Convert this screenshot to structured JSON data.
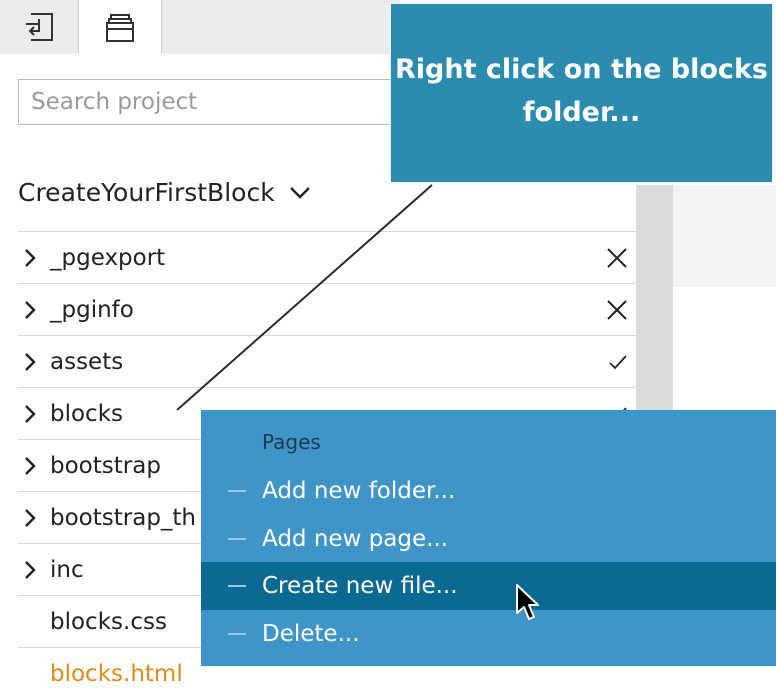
{
  "tabs": [
    {
      "icon": "export-icon"
    },
    {
      "icon": "project-archive-icon"
    }
  ],
  "search": {
    "placeholder": "Search project"
  },
  "project": {
    "title": "CreateYourFirstBlock"
  },
  "tree": [
    {
      "label": "_pgexport",
      "status": "x"
    },
    {
      "label": "_pginfo",
      "status": "x"
    },
    {
      "label": "assets",
      "status": "check"
    },
    {
      "label": "blocks",
      "status": "check"
    },
    {
      "label": "bootstrap",
      "status": ""
    },
    {
      "label": "bootstrap_th",
      "status": ""
    },
    {
      "label": "inc",
      "status": ""
    },
    {
      "label": "blocks.css",
      "status": ""
    },
    {
      "label": "blocks.html",
      "status": ""
    }
  ],
  "callout": {
    "text": "Right click on the blocks folder..."
  },
  "context_menu": {
    "header": "Pages",
    "items": [
      "Add new folder...",
      "Add new page...",
      "Create new file...",
      "Delete..."
    ],
    "selected_index": 2
  },
  "colors": {
    "callout_bg": "#2b8cb0",
    "menu_bg": "#3f95c7",
    "menu_selected": "#0b6a93",
    "file_orange": "#e08a1e"
  }
}
